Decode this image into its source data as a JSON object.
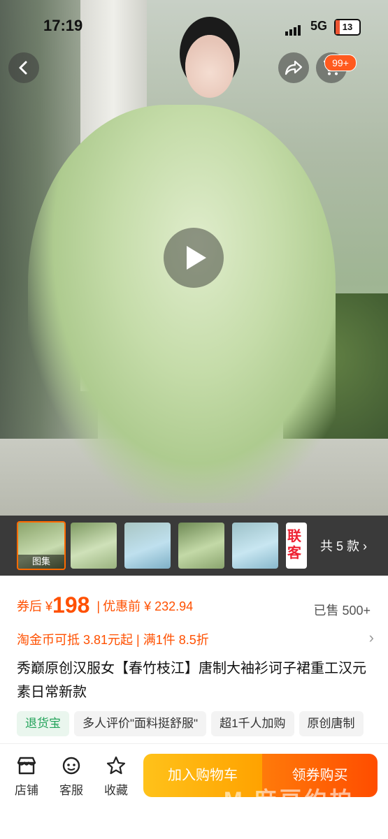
{
  "status_bar": {
    "time": "17:19",
    "network": "5G",
    "battery": "13"
  },
  "header": {
    "cart_badge": "99+"
  },
  "gallery": {
    "thumbnails": [
      {
        "label": "图集"
      },
      {
        "label": ""
      },
      {
        "label": ""
      },
      {
        "label": ""
      },
      {
        "label": ""
      },
      {
        "label": "联客"
      }
    ],
    "styles_count": "共 5 款 "
  },
  "product": {
    "coupon_price_prefix": "券后 ¥",
    "coupon_price": "198",
    "discount_label": "优惠前 ¥ 232.94",
    "sold": "已售 500+",
    "coupon_line": "淘金币可抵 3.81元起 | 满1件 8.5折",
    "title": "秀巅原创汉服女【春竹枝江】唐制大袖衫诃子裙重工汉元素日常新款",
    "tags": [
      "退货宝",
      "多人评价\"面料挺舒服\"",
      "超1千人加购",
      "原创唐制"
    ]
  },
  "bottom_bar": {
    "store": "店铺",
    "service": "客服",
    "favorite": "收藏",
    "add_to_cart": "加入购物车",
    "buy": "领券购买"
  },
  "watermark": "M 麻豆约拍"
}
